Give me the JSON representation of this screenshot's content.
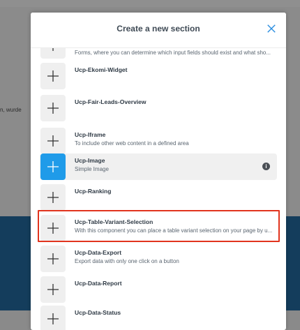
{
  "background": {
    "partial_text": "n, wurde"
  },
  "modal": {
    "title": "Create a new section",
    "close_icon": "close-icon",
    "items": [
      {
        "title": "",
        "desc": "Forms, where you can determine which input fields should exist and what sho..."
      },
      {
        "title": "Ucp-Ekomi-Widget",
        "desc": ""
      },
      {
        "title": "Ucp-Fair-Leads-Overview",
        "desc": ""
      },
      {
        "title": "Ucp-Iframe",
        "desc": "To include other web content in a defined area"
      },
      {
        "title": "Ucp-Image",
        "desc": "Simple Image",
        "info": "i"
      },
      {
        "title": "Ucp-Ranking",
        "desc": ""
      },
      {
        "title": "Ucp-Table-Variant-Selection",
        "desc": "With this component you can place a table variant selection on your page by u..."
      },
      {
        "title": "Ucp-Data-Export",
        "desc": "Export data with only one click on a button"
      },
      {
        "title": "Ucp-Data-Report",
        "desc": ""
      },
      {
        "title": "Ucp-Data-Status",
        "desc": ""
      }
    ]
  },
  "colors": {
    "accent": "#1f9be9",
    "highlight": "#e1341e",
    "band": "#143d5c"
  }
}
